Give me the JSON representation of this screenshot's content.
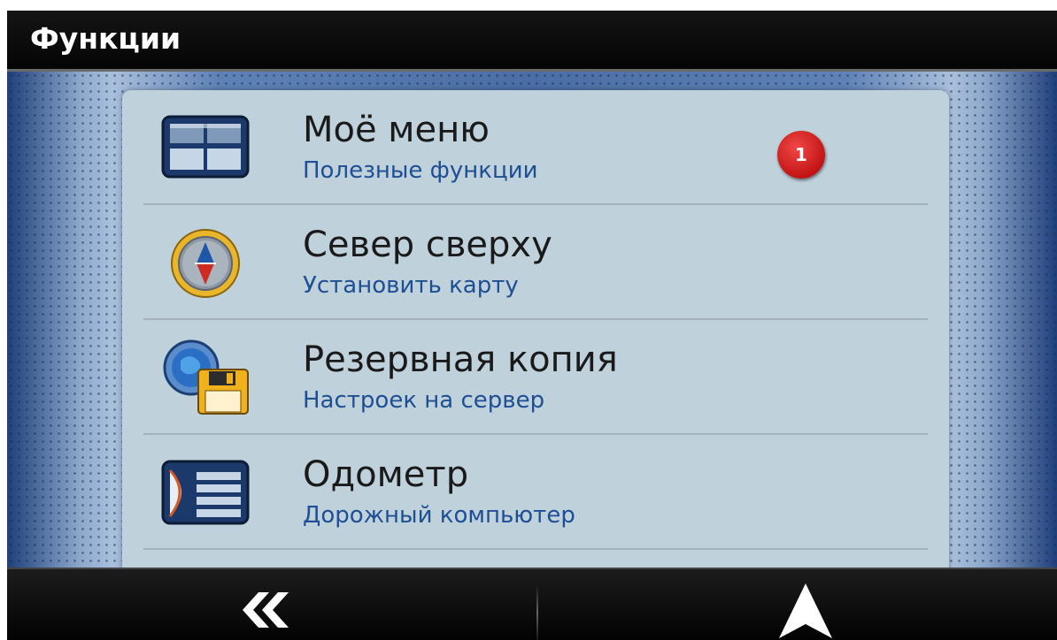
{
  "header": {
    "title": "Функции"
  },
  "menu": {
    "items": [
      {
        "icon": "my-menu-icon",
        "title": "Моё меню",
        "subtitle": "Полезные функции",
        "badge": "1"
      },
      {
        "icon": "compass-icon",
        "title": "Север сверху",
        "subtitle": "Установить карту"
      },
      {
        "icon": "backup-icon",
        "title": "Резервная копия",
        "subtitle": "Настроек на сервер"
      },
      {
        "icon": "odometer-icon",
        "title": "Одометр",
        "subtitle": "Дорожный компьютер"
      }
    ]
  },
  "footer": {
    "back_icon": "double-chevron-left-icon",
    "navigate_icon": "navigation-arrow-icon"
  },
  "colors": {
    "title_text": "#1a1a1a",
    "subtitle_text": "#1e4f94",
    "badge": "#d11a1a",
    "panel": "#bfd1db"
  }
}
